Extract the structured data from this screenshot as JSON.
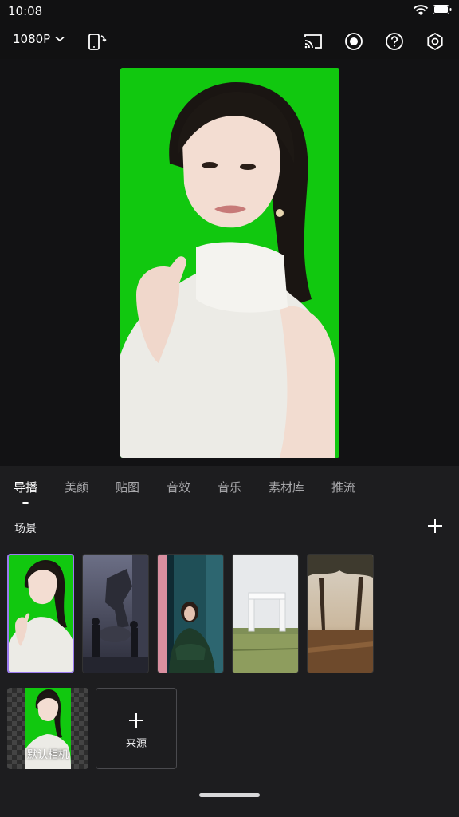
{
  "status": {
    "time": "10:08"
  },
  "toolbar": {
    "resolution": "1080P",
    "icons": [
      "switch-orientation-icon",
      "cast-icon",
      "record-icon",
      "help-icon",
      "settings-icon"
    ]
  },
  "tabs": [
    {
      "label": "导播",
      "active": true
    },
    {
      "label": "美颜",
      "active": false
    },
    {
      "label": "贴图",
      "active": false
    },
    {
      "label": "音效",
      "active": false
    },
    {
      "label": "音乐",
      "active": false
    },
    {
      "label": "素材库",
      "active": false
    },
    {
      "label": "推流",
      "active": false
    }
  ],
  "scenes": {
    "title": "场景",
    "items": [
      {
        "name": "green-screen-portrait",
        "selected": true
      },
      {
        "name": "robot-figures",
        "selected": false
      },
      {
        "name": "woman-in-green",
        "selected": false
      },
      {
        "name": "white-gate-field",
        "selected": false
      },
      {
        "name": "tree-park-sunset",
        "selected": false
      }
    ]
  },
  "sources": {
    "items": [
      {
        "label": "默认相机"
      }
    ],
    "add_label": "来源"
  },
  "colors": {
    "accent": "#9b7bf0",
    "green_screen": "#11c80f",
    "panel": "#1d1d1f",
    "background": "#111112"
  }
}
